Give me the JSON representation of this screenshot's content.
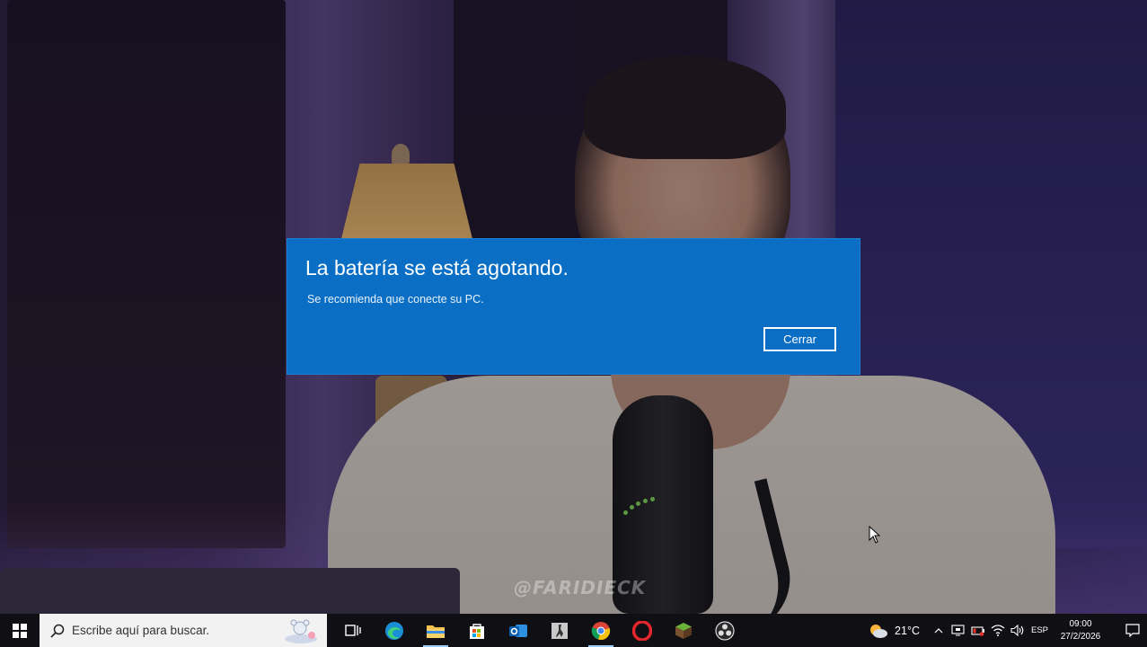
{
  "notification": {
    "title": "La batería se está agotando.",
    "message": "Se recomienda que conecte su PC.",
    "close_label": "Cerrar",
    "accent": "#0a6fc4"
  },
  "overlay": {
    "watermark": "@FARIDIECK"
  },
  "taskbar": {
    "search_placeholder": "Escribe aquí para buscar.",
    "pinned": [
      {
        "name": "task-view-icon"
      },
      {
        "name": "edge-icon"
      },
      {
        "name": "file-explorer-icon"
      },
      {
        "name": "microsoft-store-icon"
      },
      {
        "name": "outlook-icon"
      },
      {
        "name": "counter-strike-icon"
      },
      {
        "name": "chrome-icon"
      },
      {
        "name": "opera-icon"
      },
      {
        "name": "minecraft-icon"
      },
      {
        "name": "obs-icon"
      }
    ],
    "weather": {
      "temp": "21°C"
    },
    "language": "ESP",
    "time": "09:00",
    "date": "27/2/2026"
  }
}
